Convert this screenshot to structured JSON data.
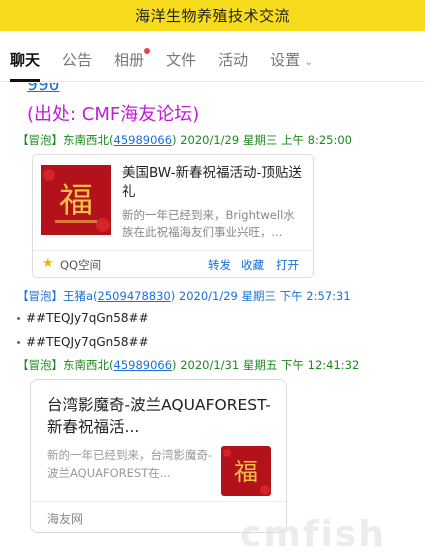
{
  "header": {
    "title": "海洋生物养殖技术交流"
  },
  "tabs": [
    {
      "label": "聊天",
      "active": true
    },
    {
      "label": "公告"
    },
    {
      "label": "相册",
      "badge": true
    },
    {
      "label": "文件"
    },
    {
      "label": "活动"
    },
    {
      "label": "设置"
    }
  ],
  "messages": {
    "cut_link": "990",
    "source_line": "(出处: CMF海友论坛)",
    "m1": {
      "tag": "【冒泡】",
      "name": "东南西北",
      "qq": "45989066",
      "time": "2020/1/29 星期三 上午 8:25:00",
      "card": {
        "title": "美国BW-新春祝福活动-顶贴送礼",
        "desc": "新的一年已经到来，Brightwell水族在此祝福海友们事业兴旺，...",
        "source": "QQ空间",
        "actions": [
          "转发",
          "收藏",
          "打开"
        ],
        "thumb_text": "福"
      }
    },
    "m2": {
      "tag": "【冒泡】",
      "name": "王猪a",
      "qq": "2509478830",
      "time": "2020/1/29 星期三 下午 2:57:31",
      "lines": [
        "##TEQJy7qGn58##",
        "##TEQJy7qGn58##"
      ]
    },
    "m3": {
      "tag": "【冒泡】",
      "name": "东南西北",
      "qq": "45989066",
      "time": "2020/1/31 星期五 下午 12:41:32",
      "card": {
        "title": "台湾影魔奇-波兰AQUAFOREST-新春祝福活...",
        "desc": "新的一年已经到来，台湾影魔奇-波兰AQUAFOREST在...",
        "source": "海友网",
        "thumb_text": "福"
      }
    }
  },
  "watermark": "cmfish",
  "colors": {
    "topbar": "#f7dc1e",
    "link": "#1a6fd8",
    "source": "#c21bd6",
    "meta_green": "#1a8a1a",
    "thumb_red": "#b3121a",
    "thumb_gold": "#f2c14a"
  }
}
